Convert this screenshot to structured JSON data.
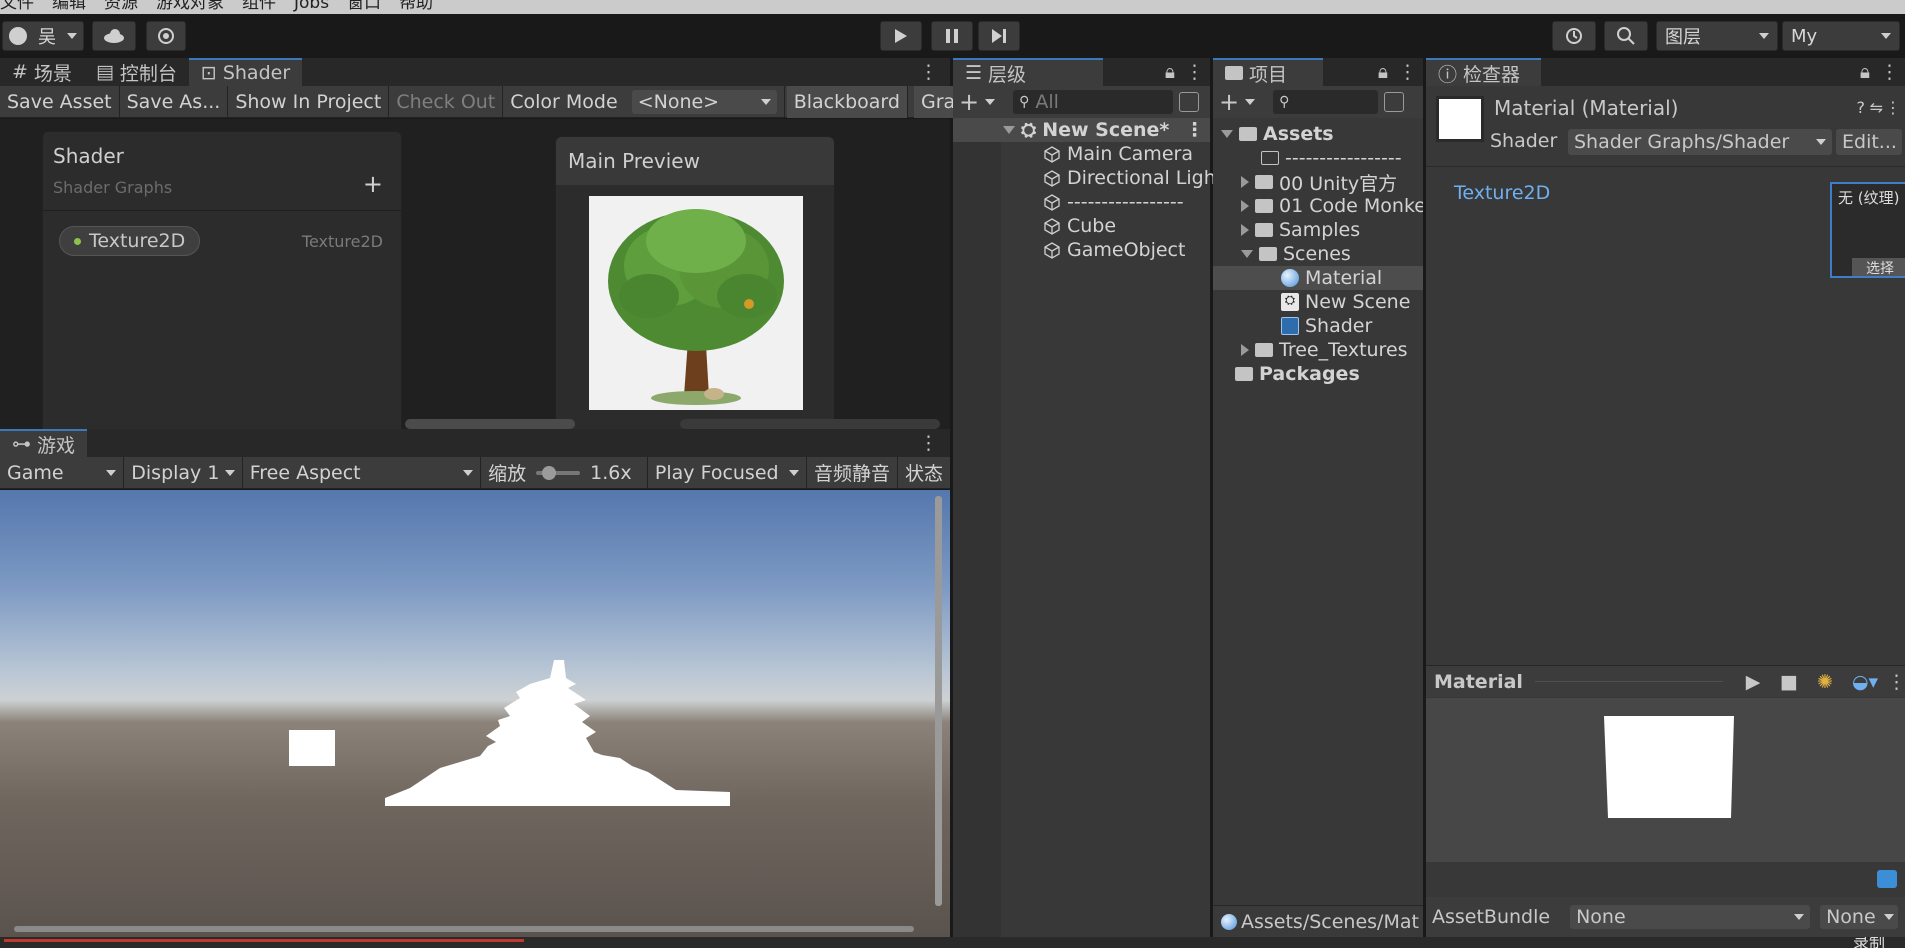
{
  "menu": [
    "文件",
    "编辑",
    "资源",
    "游戏对象",
    "组件",
    "Jobs",
    "窗口",
    "帮助"
  ],
  "toolbar": {
    "account": "吴",
    "layers": "图层",
    "layout": "My"
  },
  "shader_panel": {
    "tabs": [
      "场景",
      "控制台",
      "Shader"
    ],
    "bar": {
      "save_asset": "Save Asset",
      "save_as": "Save As...",
      "show_in_project": "Show In Project",
      "check_out": "Check Out",
      "color_mode_label": "Color Mode",
      "color_mode_value": "<None>",
      "blackboard": "Blackboard",
      "graph": "Grap"
    },
    "blackboard": {
      "title": "Shader",
      "subtitle": "Shader Graphs",
      "property_name": "Texture2D",
      "property_type": "Texture2D"
    },
    "preview": {
      "title": "Main Preview"
    }
  },
  "game_panel": {
    "tab": "游戏",
    "bar": {
      "mode": "Game",
      "display": "Display 1",
      "aspect": "Free Aspect",
      "scale_label": "缩放",
      "scale_value": "1.6x",
      "focus": "Play Focused",
      "mute": "音频静音",
      "stats": "状态"
    }
  },
  "hierarchy": {
    "tab": "层级",
    "search_placeholder": "All",
    "scene": "New Scene*",
    "items": [
      "Main Camera",
      "Directional Ligh",
      "-----------------",
      "Cube",
      "GameObject"
    ]
  },
  "project": {
    "tab": "项目",
    "assets": "Assets",
    "items": [
      {
        "label": "-----------------",
        "depth": 1,
        "kind": "folder-empty"
      },
      {
        "label": "00 Unity官方",
        "depth": 1,
        "kind": "folder-closed"
      },
      {
        "label": "01 Code Monke",
        "depth": 1,
        "kind": "folder-closed"
      },
      {
        "label": "Samples",
        "depth": 1,
        "kind": "folder-closed"
      },
      {
        "label": "Scenes",
        "depth": 1,
        "kind": "folder-open"
      },
      {
        "label": "Material",
        "depth": 2,
        "kind": "material"
      },
      {
        "label": "New Scene",
        "depth": 2,
        "kind": "scene"
      },
      {
        "label": "Shader",
        "depth": 2,
        "kind": "shader"
      },
      {
        "label": "Tree_Textures",
        "depth": 1,
        "kind": "folder-closed"
      }
    ],
    "packages": "Packages",
    "footer_path": "Assets/Scenes/Mat"
  },
  "inspector": {
    "tab": "检查器",
    "title": "Material (Material)",
    "shader_label": "Shader",
    "shader_value": "Shader Graphs/Shader",
    "edit": "Edit...",
    "property": "Texture2D",
    "texture_slot": "无 (纹理)",
    "select": "选择",
    "preview_title": "Material",
    "assetbundle_label": "AssetBundle",
    "assetbundle_value": "None",
    "assetbundle_variant": "None"
  },
  "status": {
    "corner": "录制"
  }
}
